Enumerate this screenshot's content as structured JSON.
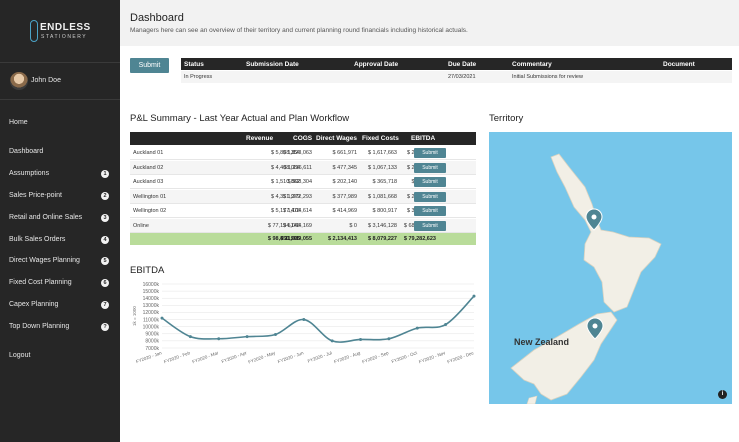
{
  "sidebar": {
    "logo": {
      "line1": "ENDLESS",
      "line2": "STATIONERY"
    },
    "user": {
      "name": "John Doe"
    },
    "items": [
      {
        "label": "Home",
        "badge": ""
      },
      {
        "label": "Dashboard",
        "badge": ""
      },
      {
        "label": "Assumptions",
        "badge": "1"
      },
      {
        "label": "Sales Price-point",
        "badge": "2"
      },
      {
        "label": "Retail and Online Sales",
        "badge": "3"
      },
      {
        "label": "Bulk Sales Orders",
        "badge": "4"
      },
      {
        "label": "Direct Wages Planning",
        "badge": "5"
      },
      {
        "label": "Fixed Cost Planning",
        "badge": "6"
      },
      {
        "label": "Capex Planning",
        "badge": "7"
      },
      {
        "label": "Top Down Planning",
        "badge": "?"
      },
      {
        "label": "Logout",
        "badge": ""
      }
    ]
  },
  "header": {
    "title": "Dashboard",
    "subtitle": "Managers here can see an overview of their territory and current planning round financials including historical actuals."
  },
  "submission": {
    "button": "Submit",
    "columns": [
      "Status",
      "Submission Date",
      "Approval Date",
      "Due Date",
      "Commentary",
      "Document"
    ],
    "row": {
      "status": "In Progress",
      "submission_date": "",
      "approval_date": "",
      "due_date": "27/03/2021",
      "commentary": "Initial Submissions for review",
      "document": ""
    }
  },
  "pl_summary": {
    "title": "P&L Summary - Last Year Actual and Plan Workflow",
    "columns": [
      "",
      "Revenue",
      "COGS",
      "Direct Wages",
      "Fixed Costs",
      "EBITDA",
      ""
    ],
    "rows": [
      {
        "name": "Auckland 01",
        "revenue": "$ 5,808,354",
        "cogs": "$ 1,823,063",
        "wages": "$ 661,971",
        "fixed": "$ 1,617,663",
        "ebitda": "$ 2,167,628",
        "action": "Submit"
      },
      {
        "name": "Auckland 02",
        "revenue": "$ 4,408,084",
        "cogs": "$ 1,216,611",
        "wages": "$ 477,345",
        "fixed": "$ 1,067,133",
        "ebitda": "$ 2,124,340",
        "action": "Submit"
      },
      {
        "name": "Auckland 03",
        "revenue": "$ 1,510,862",
        "cogs": "$ 508,304",
        "wages": "$ 202,140",
        "fixed": "$ 365,718",
        "ebitda": "$ 636,840",
        "action": "Submit"
      },
      {
        "name": "Wellington 01",
        "revenue": "$ 4,351,979",
        "cogs": "$ 1,372,293",
        "wages": "$ 377,989",
        "fixed": "$ 1,081,668",
        "ebitda": "$ 2,098,018",
        "action": "Submit"
      },
      {
        "name": "Wellington 02",
        "revenue": "$ 5,177,478",
        "cogs": "$ 1,104,614",
        "wages": "$ 414,969",
        "fixed": "$ 800,917",
        "ebitda": "$ 3,271,947",
        "action": "Submit"
      },
      {
        "name": "Online",
        "revenue": "$ 77,194,148",
        "cogs": "$ 5,064,169",
        "wages": "$ 0",
        "fixed": "$ 3,146,128",
        "ebitda": "$ 68,983,850",
        "action": "Submit"
      }
    ],
    "total": {
      "revenue": "$ 98,450,905",
      "cogs": "$ 11,089,055",
      "wages": "$ 2,134,413",
      "fixed": "$ 8,079,227",
      "ebitda": "$ 79,282,623"
    }
  },
  "ebitda": {
    "title": "EBITDA"
  },
  "territory": {
    "title": "Territory",
    "country_label": "New Zealand",
    "info": "i"
  },
  "chart_data": {
    "type": "line",
    "title": "EBITDA",
    "ylabel": "1k = 1000",
    "categories": [
      "FY2020 - Jan",
      "FY2020 - Feb",
      "FY2020 - Mar",
      "FY2020 - Apr",
      "FY2020 - May",
      "FY2020 - Jun",
      "FY2020 - Jul",
      "FY2020 - Aug",
      "FY2020 - Sep",
      "FY2020 - Oct",
      "FY2020 - Nov",
      "FY2020 - Dec"
    ],
    "series": [
      {
        "values": [
          11200,
          8600,
          8300,
          8600,
          8900,
          11000,
          8000,
          8200,
          8300,
          9800,
          10300,
          14300
        ]
      }
    ],
    "yticks": [
      "7000k",
      "8000k",
      "9000k",
      "10000k",
      "11000k",
      "12000k",
      "13000k",
      "14000k",
      "15000k",
      "16000k"
    ],
    "ylim": [
      7000,
      16000
    ],
    "grid": true,
    "color": "#4f8593"
  }
}
